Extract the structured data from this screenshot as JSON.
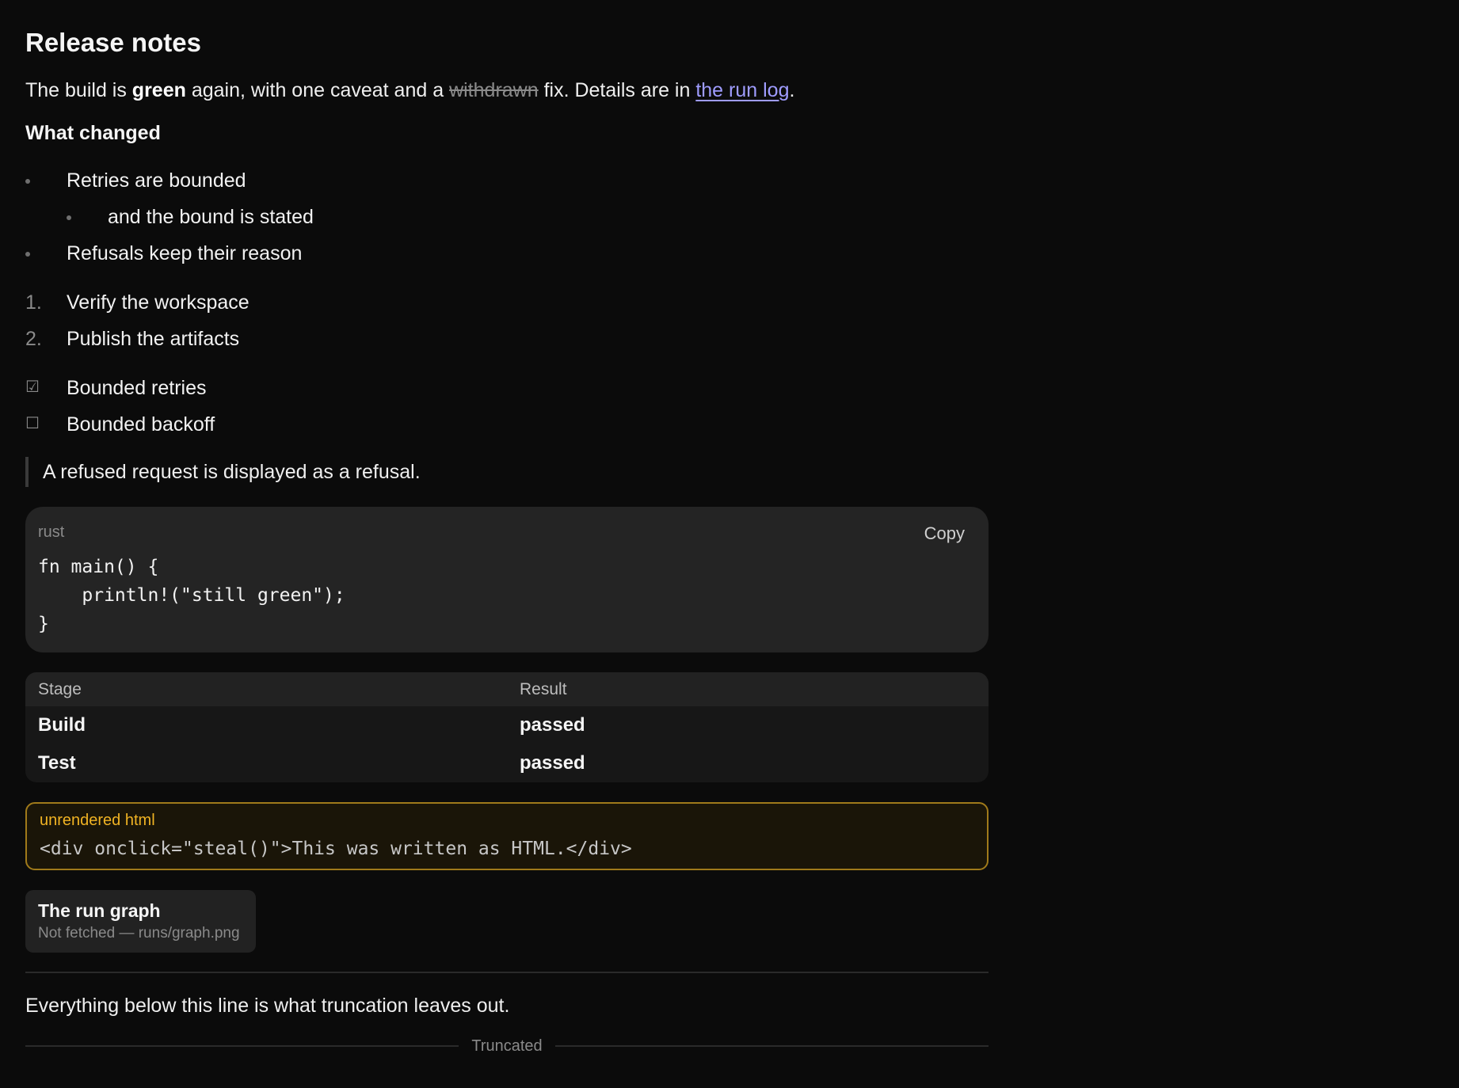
{
  "title": "Release notes",
  "intro": {
    "part1": "The build is ",
    "bold": "green",
    "part2": " again, with one caveat and a ",
    "strike": "withdrawn",
    "part3": " fix. Details are in ",
    "link": "the run log",
    "part4": "."
  },
  "section_heading": "What changed",
  "bullets": [
    {
      "text": "Retries are bounded",
      "nested": false
    },
    {
      "text": "and the bound is stated",
      "nested": true
    },
    {
      "text": "Refusals keep their reason",
      "nested": false
    }
  ],
  "steps": [
    {
      "marker": "1.",
      "text": "Verify the workspace"
    },
    {
      "marker": "2.",
      "text": "Publish the artifacts"
    }
  ],
  "tasks": [
    {
      "checked": true,
      "box": "☑",
      "text": "Bounded retries"
    },
    {
      "checked": false,
      "box": "☐",
      "text": "Bounded backoff"
    }
  ],
  "quote": "A refused request is displayed as a refusal.",
  "code": {
    "lang": "rust",
    "copy_label": "Copy",
    "content": "fn main() {\n    println!(\"still green\");\n}"
  },
  "table": {
    "headers": [
      "Stage",
      "Result"
    ],
    "rows": [
      [
        "Build",
        "passed"
      ],
      [
        "Test",
        "passed"
      ]
    ]
  },
  "unrendered": {
    "label": "unrendered html",
    "code": "<div onclick=\"steal()\">This was written as HTML.</div>"
  },
  "image_card": {
    "title": "The run graph",
    "subtitle": "Not fetched — runs/graph.png"
  },
  "after_rule": "Everything below this line is what truncation leaves out.",
  "truncated_label": "Truncated",
  "colors": {
    "background": "#0b0b0b",
    "link": "#9f9cff",
    "warning_border": "#a07a1a",
    "warning_label": "#f0b323",
    "card": "#242424"
  }
}
